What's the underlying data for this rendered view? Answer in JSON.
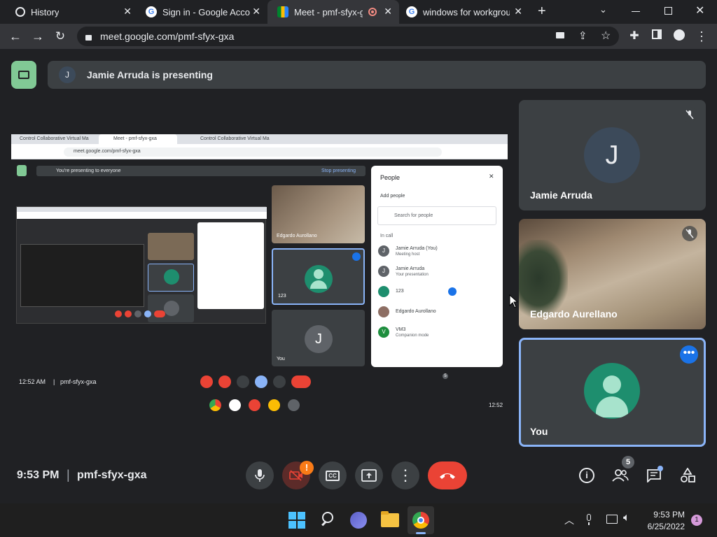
{
  "browser": {
    "tabs": [
      {
        "label": "History",
        "active": false
      },
      {
        "label": "Sign in - Google Accou",
        "active": false
      },
      {
        "label": "Meet - pmf-sfyx-g",
        "active": true
      },
      {
        "label": "windows for workgroup",
        "active": false
      }
    ],
    "new_tab": "+",
    "url": "meet.google.com/pmf-sfyx-gxa",
    "window_controls": [
      "minimize-icon",
      "restore-icon",
      "close-icon"
    ]
  },
  "meet": {
    "presenter_initial": "J",
    "presenter_text": "Jamie Arruda is presenting",
    "participants": [
      {
        "name": "Jamie Arruda",
        "initial": "J",
        "muted": true
      },
      {
        "name": "Edgardo Aurellano",
        "muted": true
      },
      {
        "name": "You",
        "active_speaker": true
      }
    ],
    "time": "9:53 PM",
    "separator": "|",
    "meeting_code": "pmf-sfyx-gxa",
    "people_count": "5",
    "camera_alert": "!",
    "accent": "#8ab4f8",
    "leave_color": "#ea4335"
  },
  "shared_screen": {
    "tabs": [
      "Control Collaborative Virtual Ma",
      "Meet - pmf-sfyx-gxa",
      "Control Collaborative Virtual Ma"
    ],
    "url": "meet.google.com/pmf-sfyx-gxa",
    "banner": "You're presenting to everyone",
    "stop": "Stop presenting",
    "tiles": [
      {
        "name": "Edgardo Aurollano"
      },
      {
        "name": "123",
        "initial": ""
      },
      {
        "name": "You",
        "initial": "J"
      }
    ],
    "people_panel": {
      "title": "People",
      "add": "Add people",
      "search_placeholder": "Search for people",
      "section": "In call",
      "people": [
        {
          "initial": "J",
          "name": "Jamie Arruda (You)",
          "sub": "Meeting host"
        },
        {
          "initial": "J",
          "name": "Jamie Arruda",
          "sub": "Your presentation"
        },
        {
          "initial": "",
          "name": "123",
          "sub": ""
        },
        {
          "initial": "",
          "name": "Edgardo Aurollano",
          "sub": ""
        },
        {
          "initial": "V",
          "name": "VM3",
          "sub": "Companion mode"
        }
      ]
    },
    "time": "12:52 AM",
    "code": "pmf-sfyx-gxa",
    "people_count": "5",
    "clock": "12:52"
  },
  "taskbar": {
    "time": "9:53 PM",
    "date": "6/25/2022",
    "notifications": "1"
  }
}
